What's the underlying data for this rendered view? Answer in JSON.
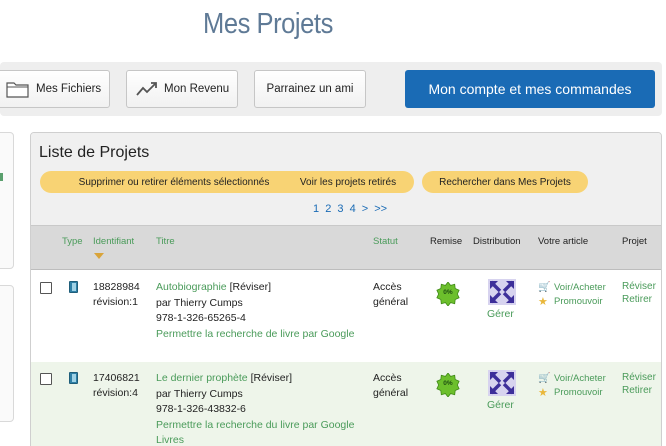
{
  "page_title": "Mes Projets",
  "toolbar": {
    "files_label": "Mes Fichiers",
    "revenue_label": "Mon Revenu",
    "sponsor_label": "Parrainez un ami",
    "account_label": "Mon compte et mes commandes"
  },
  "panel": {
    "title": "Liste de Projets",
    "actions": {
      "delete_label": "Supprimer ou retirer éléments sélectionnés",
      "retired_label": "Voir les projets retirés",
      "search_label": "Rechercher dans Mes Projets"
    },
    "pagination": [
      "1",
      "2",
      "3",
      "4",
      ">",
      ">>"
    ]
  },
  "table": {
    "headers": {
      "type": "Type",
      "id": "Identifiant",
      "title": "Titre",
      "status": "Statut",
      "discount": "Remise",
      "distribution": "Distribution",
      "article": "Votre article",
      "project": "Projet"
    },
    "rows": [
      {
        "id": "18828984",
        "revision": "révision:1",
        "title": "Autobiographie",
        "revise_bracket": "[Réviser]",
        "author": "par Thierry Cumps",
        "isbn": "978-1-326-65265-4",
        "google": "Permettre la recherche de livre par Google",
        "status": "Accès général",
        "discount": "0%",
        "distribution": "Gérer",
        "article_buy": "Voir/Acheter",
        "article_promote": "Promouvoir",
        "project_revise": "Réviser",
        "project_retire": "Retirer"
      },
      {
        "id": "17406821",
        "revision": "révision:4",
        "title": "Le dernier prophète",
        "revise_bracket": "[Réviser]",
        "author": "par Thierry Cumps",
        "isbn": "978-1-326-43832-6",
        "google": "Permettre la recherche du livre par Google Livres",
        "status": "Accès général",
        "discount": "0%",
        "distribution": "Gérer",
        "article_buy": "Voir/Acheter",
        "article_promote": "Promouvoir",
        "project_revise": "Réviser",
        "project_retire": "Retirer"
      }
    ]
  },
  "colors": {
    "accent_blue": "#1a6bb5",
    "link_green": "#4a9b5a",
    "pill_yellow": "#f8d374",
    "title_slate": "#5f7a96"
  }
}
